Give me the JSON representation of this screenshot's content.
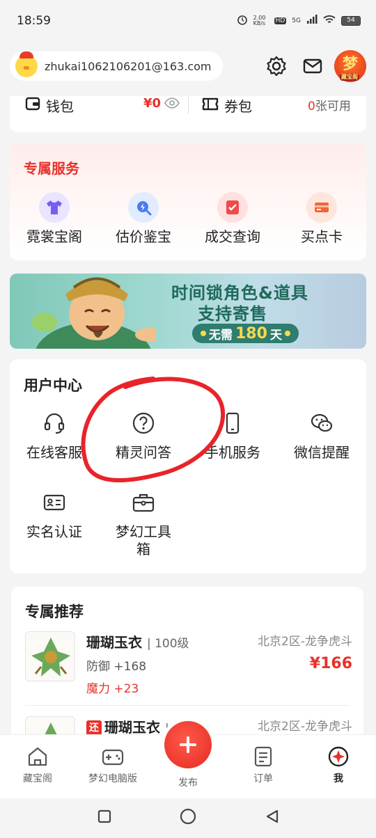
{
  "status_bar": {
    "time": "18:59",
    "net_speed": "2.00\nKB/s",
    "hd": "HD",
    "signal": "5G",
    "battery": "54"
  },
  "header": {
    "email": "zhukai1062106201@163.com",
    "avatar_text": "梦",
    "avatar_sub": "藏宝阁"
  },
  "wallet": {
    "wallet_label": "钱包",
    "wallet_amount": "¥0",
    "coupon_label": "券包",
    "coupon_count": "0",
    "coupon_suffix": "张可用"
  },
  "exclusive_services": {
    "title": "专属服务",
    "items": [
      {
        "label": "霓裳宝阁",
        "icon": "tshirt-icon"
      },
      {
        "label": "估价鉴宝",
        "icon": "appraise-icon"
      },
      {
        "label": "成交查询",
        "icon": "deal-query-icon"
      },
      {
        "label": "买点卡",
        "icon": "card-icon"
      }
    ]
  },
  "banner": {
    "line1": "时间锁角色&道具",
    "line2": "支持寄售",
    "pill_prefix": "无需",
    "pill_number": "180",
    "pill_suffix": "天"
  },
  "user_center": {
    "title": "用户中心",
    "items": [
      {
        "label": "在线客服",
        "icon": "headset-icon"
      },
      {
        "label": "精灵问答",
        "icon": "question-icon"
      },
      {
        "label": "手机服务",
        "icon": "phone-icon"
      },
      {
        "label": "微信提醒",
        "icon": "wechat-icon"
      },
      {
        "label": "实名认证",
        "icon": "id-card-icon"
      },
      {
        "label": "梦幻工具箱",
        "icon": "toolbox-icon"
      }
    ]
  },
  "recommend": {
    "title": "专属推荐",
    "items": [
      {
        "name": "珊瑚玉衣",
        "level": "| 100级",
        "stat1": "防御 +168",
        "stat2": "魔力 +23",
        "server": "北京2区-龙争虎斗",
        "price": "¥166",
        "tag": ""
      },
      {
        "name": "珊瑚玉衣",
        "level": "|",
        "stat1": "",
        "stat2": "",
        "server": "北京2区-龙争虎斗",
        "price": "",
        "tag": "还"
      }
    ]
  },
  "tabbar": {
    "items": [
      {
        "label": "藏宝阁",
        "icon": "home-icon"
      },
      {
        "label": "梦幻电脑版",
        "icon": "gamepad-icon"
      },
      {
        "label": "发布",
        "icon": "plus-icon"
      },
      {
        "label": "订单",
        "icon": "order-icon"
      },
      {
        "label": "我",
        "icon": "me-icon"
      }
    ],
    "active": "我"
  },
  "colors": {
    "accent": "#e8312a",
    "service_bg": "#ffecec",
    "banner_green": "#2e7d6e"
  }
}
